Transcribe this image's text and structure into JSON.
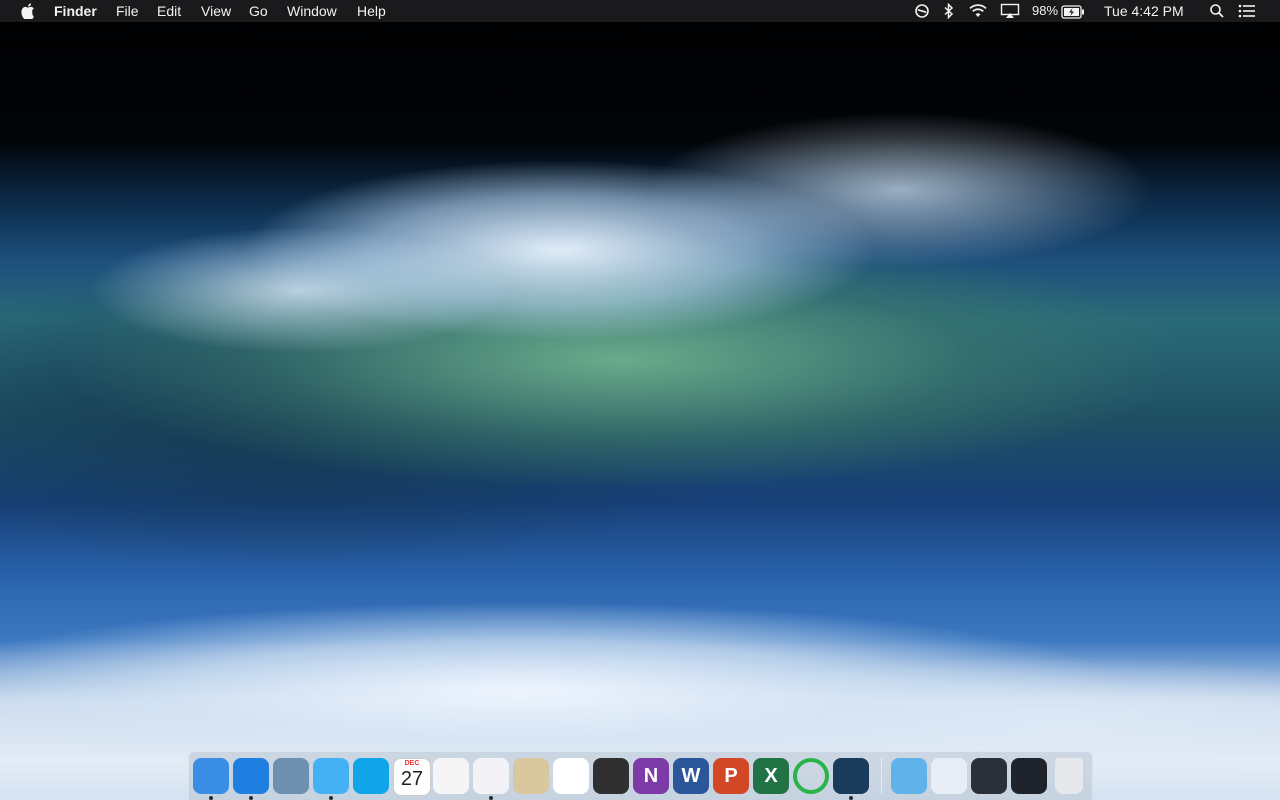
{
  "menubar": {
    "apple_icon": "apple-logo-icon",
    "app_name": "Finder",
    "menus": [
      "File",
      "Edit",
      "View",
      "Go",
      "Window",
      "Help"
    ],
    "status": {
      "icons": [
        "do-not-disturb-icon",
        "bluetooth-icon",
        "wifi-icon",
        "airplay-icon",
        "battery-icon",
        "spotlight-search-icon",
        "notification-center-icon"
      ],
      "battery_percent": "98%",
      "clock": "Tue 4:42 PM"
    }
  },
  "desktop": {
    "wallpaper": "ocean wave"
  },
  "dock": {
    "apps": [
      {
        "icon": "finder-icon",
        "running": true,
        "color": "#3a8ee6"
      },
      {
        "icon": "safari-icon",
        "running": true,
        "color": "#1e7fe0"
      },
      {
        "icon": "mail-stamp-icon",
        "running": false,
        "color": "#6f8fb0"
      },
      {
        "icon": "messages-icon",
        "running": true,
        "color": "#45b1f5"
      },
      {
        "icon": "skype-icon",
        "running": false,
        "color": "#10a5e8"
      },
      {
        "icon": "calendar-icon",
        "running": false,
        "color": "#ffffff",
        "month": "DEC",
        "day": "27"
      },
      {
        "icon": "reminders-icon",
        "running": false,
        "color": "#f5f5f5"
      },
      {
        "icon": "itunes-icon",
        "running": true,
        "color": "#f2f2f7"
      },
      {
        "icon": "preview-icon",
        "running": false,
        "color": "#d9c7a0"
      },
      {
        "icon": "photos-icon",
        "running": false,
        "color": "#ffffff"
      },
      {
        "icon": "disk-utility-icon",
        "running": false,
        "color": "#303030"
      },
      {
        "icon": "onenote-icon",
        "running": false,
        "color": "#7d3ba8",
        "letter": "N"
      },
      {
        "icon": "word-icon",
        "running": false,
        "color": "#2b579a",
        "letter": "W"
      },
      {
        "icon": "powerpoint-icon",
        "running": false,
        "color": "#d24726",
        "letter": "P"
      },
      {
        "icon": "excel-icon",
        "running": false,
        "color": "#217346",
        "letter": "X"
      },
      {
        "icon": "green-ring-app-icon",
        "running": false,
        "color": "#29b34a"
      },
      {
        "icon": "steam-icon",
        "running": true,
        "color": "#1b3b5c"
      }
    ],
    "stacks": [
      {
        "icon": "downloads-folder-icon",
        "color": "#5fb3e8"
      },
      {
        "icon": "documents-stack-icon",
        "color": "#e8eef5"
      },
      {
        "icon": "screenshot-stack-icon",
        "color": "#2a2f38"
      },
      {
        "icon": "archive-stack-icon",
        "color": "#1f232b"
      },
      {
        "icon": "trash-icon",
        "color": "#e6e8eb"
      }
    ]
  }
}
